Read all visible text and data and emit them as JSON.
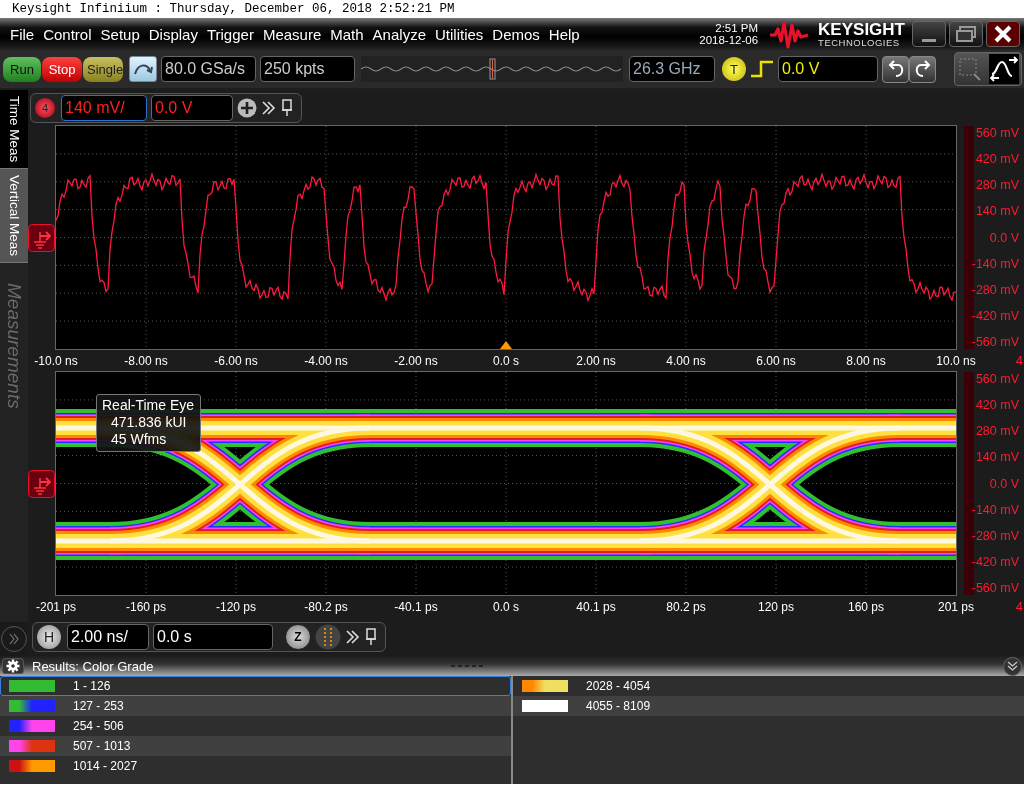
{
  "window": {
    "title": "Keysight Infiniium : Thursday, December 06, 2018 2:52:21 PM"
  },
  "menu": [
    "File",
    "Control",
    "Setup",
    "Display",
    "Trigger",
    "Measure",
    "Math",
    "Analyze",
    "Utilities",
    "Demos",
    "Help"
  ],
  "clock": {
    "time": "2:51 PM",
    "date": "2018-12-06"
  },
  "logo": {
    "name": "KEYSIGHT",
    "subtitle": "TECHNOLOGIES"
  },
  "toolbar": {
    "buttons": [
      {
        "label": "Run",
        "kind": "run"
      },
      {
        "label": "Stop",
        "kind": "stop"
      },
      {
        "label": "Single",
        "kind": "single"
      }
    ],
    "sample_rate": "80.0 GSa/s",
    "memory_depth": "250 kpts",
    "bandwidth": "26.3 GHz",
    "trigger_badge": "T",
    "trigger_level": "0.0 V"
  },
  "side_tabs": [
    {
      "label": "Time Meas",
      "selected": true
    },
    {
      "label": "Vertical Meas",
      "selected": false
    }
  ],
  "side_panel": {
    "title": "Measurements"
  },
  "channel_bar": {
    "badge": "4",
    "scale": "140 mV/",
    "offset": "0.0 V"
  },
  "waveform_plot": {
    "x_labels": [
      "-10.0 ns",
      "-8.00 ns",
      "-6.00 ns",
      "-4.00 ns",
      "-2.00 ns",
      "0.0 s",
      "2.00 ns",
      "4.00 ns",
      "6.00 ns",
      "8.00 ns",
      "10.0 ns"
    ],
    "y_labels": [
      "560 mV",
      "420 mV",
      "280 mV",
      "140 mV",
      "0.0 V",
      "-140 mV",
      "-280 mV",
      "-420 mV",
      "-560 mV"
    ],
    "channel": "4"
  },
  "eye_plot": {
    "x_labels": [
      "-201 ps",
      "-160 ps",
      "-120 ps",
      "-80.2 ps",
      "-40.1 ps",
      "0.0 s",
      "40.1 ps",
      "80.2 ps",
      "120 ps",
      "160 ps",
      "201 ps"
    ],
    "y_labels": [
      "560 mV",
      "420 mV",
      "280 mV",
      "140 mV",
      "0.0 V",
      "-140 mV",
      "-280 mV",
      "-420 mV",
      "-560 mV"
    ],
    "channel": "4",
    "info": [
      "Real-Time Eye",
      "471.836 kUI",
      "45 Wfms"
    ]
  },
  "horizontal_bar": {
    "badge": "H",
    "scale": "2.00 ns/",
    "position": "0.0 s",
    "zoom_badge": "Z"
  },
  "results": {
    "title": "Results: Color Grade",
    "columns": [
      [
        {
          "range": "1 - 126",
          "swatch": [
            {
              "color": "#33bb33"
            }
          ],
          "selected": true
        },
        {
          "range": "127 - 253",
          "swatch": [
            {
              "color": "#33bb33"
            },
            {
              "color": "#2222ff"
            }
          ],
          "selected": false
        },
        {
          "range": "254 - 506",
          "swatch": [
            {
              "color": "#2222ff"
            },
            {
              "color": "#ff44ee"
            }
          ],
          "selected": false
        },
        {
          "range": "507 - 1013",
          "swatch": [
            {
              "color": "#ff44ee"
            },
            {
              "color": "#dd3311"
            }
          ],
          "selected": false
        },
        {
          "range": "1014 - 2027",
          "swatch": [
            {
              "color": "#cc1111"
            },
            {
              "color": "#ff9900"
            }
          ],
          "selected": false
        }
      ],
      [
        {
          "range": "2028 - 4054",
          "swatch": [
            {
              "color": "#ff8800"
            },
            {
              "color": "#f0e060"
            }
          ],
          "selected": false
        },
        {
          "range": "4055 - 8109",
          "swatch": [
            {
              "color": "#ffffff"
            }
          ],
          "selected": false
        }
      ]
    ]
  }
}
